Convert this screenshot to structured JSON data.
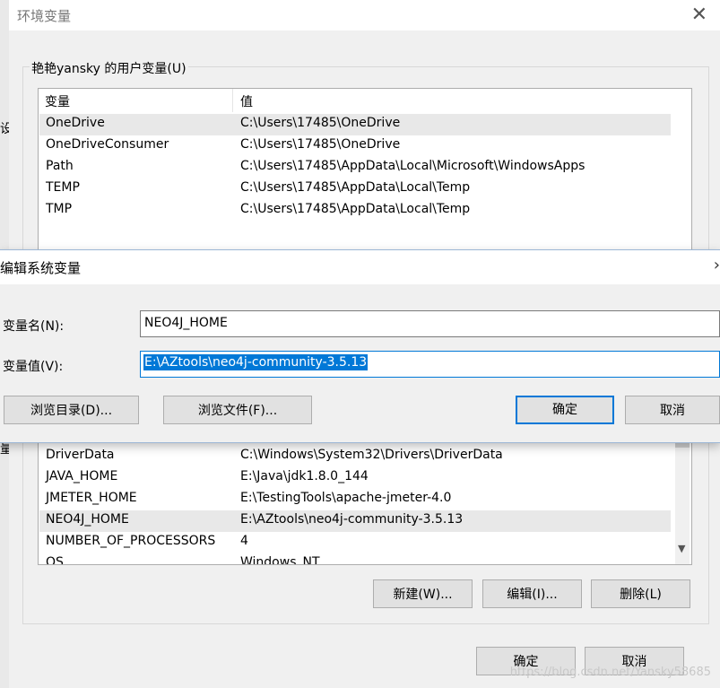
{
  "env_window": {
    "title": "环境变量",
    "close_icon": "close-icon",
    "user_group_label": "艳艳yansky 的用户变量(U)",
    "user_table": {
      "columns": [
        "变量",
        "值"
      ],
      "rows": [
        {
          "name": "OneDrive",
          "value": "C:\\Users\\17485\\OneDrive"
        },
        {
          "name": "OneDriveConsumer",
          "value": "C:\\Users\\17485\\OneDrive"
        },
        {
          "name": "Path",
          "value": "C:\\Users\\17485\\AppData\\Local\\Microsoft\\WindowsApps"
        },
        {
          "name": "TEMP",
          "value": "C:\\Users\\17485\\AppData\\Local\\Temp"
        },
        {
          "name": "TMP",
          "value": "C:\\Users\\17485\\AppData\\Local\\Temp"
        }
      ],
      "selected_index": 0
    },
    "system_table": {
      "rows": [
        {
          "name": "DriverData",
          "value": "C:\\Windows\\System32\\Drivers\\DriverData"
        },
        {
          "name": "JAVA_HOME",
          "value": "E:\\Java\\jdk1.8.0_144"
        },
        {
          "name": "JMETER_HOME",
          "value": "E:\\TestingTools\\apache-jmeter-4.0"
        },
        {
          "name": "NEO4J_HOME",
          "value": "E:\\AZtools\\neo4j-community-3.5.13"
        },
        {
          "name": "NUMBER_OF_PROCESSORS",
          "value": "4"
        },
        {
          "name": "OS",
          "value": "Windows_NT"
        }
      ],
      "selected_index": 3
    },
    "system_buttons": {
      "new": "新建(W)...",
      "edit": "编辑(I)...",
      "delete": "删除(L)"
    },
    "ok": "确定",
    "cancel": "取消"
  },
  "left_sliver": {
    "fragment_top": "设",
    "fragment_bottom": "量"
  },
  "edit_dialog": {
    "title": "编辑系统变量",
    "close_icon": "chevron-right-icon",
    "name_label": "变量名(N):",
    "name_value": "NEO4J_HOME",
    "value_label": "变量值(V):",
    "value_value": "E:\\AZtools\\neo4j-community-3.5.13",
    "browse_dir": "浏览目录(D)...",
    "browse_file": "浏览文件(F)...",
    "ok": "确定",
    "cancel": "取消"
  },
  "watermark": "https://blog.csdn.net/Yansky58685",
  "colors": {
    "accent": "#0078d7",
    "selection": "#e8e8e8"
  }
}
